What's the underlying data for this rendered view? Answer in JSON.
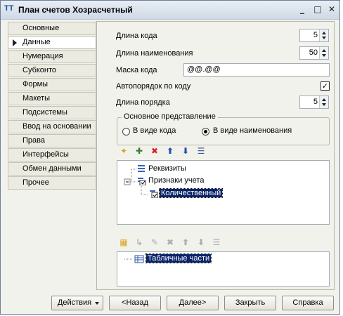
{
  "window": {
    "title": "План счетов Хозрасчетный",
    "app_icon": "ТТ"
  },
  "titlebar_buttons": {
    "minimize": "_",
    "maximize": "□",
    "close": "✕"
  },
  "nav": {
    "items": [
      {
        "label": "Основные"
      },
      {
        "label": "Данные",
        "active": true
      },
      {
        "label": "Нумерация"
      },
      {
        "label": "Субконто"
      },
      {
        "label": "Формы"
      },
      {
        "label": "Макеты"
      },
      {
        "label": "Подсистемы"
      },
      {
        "label": "Ввод на основании"
      },
      {
        "label": "Права"
      },
      {
        "label": "Интерфейсы"
      },
      {
        "label": "Обмен данными"
      },
      {
        "label": "Прочее"
      }
    ]
  },
  "fields": {
    "code_length": {
      "label": "Длина кода",
      "value": "5"
    },
    "name_length": {
      "label": "Длина наименования",
      "value": "50"
    },
    "code_mask": {
      "label": "Маска кода",
      "value": "@@.@@"
    },
    "auto_order": {
      "label": "Автопорядок по коду",
      "checked": true
    },
    "order_length": {
      "label": "Длина порядка",
      "value": "5"
    }
  },
  "representation": {
    "title": "Основное представление",
    "options": [
      {
        "label": "В виде кода",
        "selected": false
      },
      {
        "label": "В виде наименования",
        "selected": true
      }
    ]
  },
  "tree1": {
    "toolbar_icons": [
      "add-icon",
      "add-child-icon",
      "delete-icon",
      "move-up-icon",
      "move-down-icon",
      "sort-icon"
    ],
    "nodes": [
      {
        "label": "Реквизиты"
      },
      {
        "label": "Признаки учета"
      },
      {
        "label": "Количественный",
        "selected": true
      }
    ]
  },
  "tree2": {
    "toolbar_icons": [
      "add-icon",
      "add-child-icon",
      "edit-icon",
      "delete-icon",
      "move-up-icon",
      "move-down-icon",
      "sort-icon"
    ],
    "nodes": [
      {
        "label": "Табличные части"
      }
    ]
  },
  "buttons": {
    "actions": "Действия",
    "back": "<Назад",
    "next": "Далее>",
    "close": "Закрыть",
    "help": "Справка"
  },
  "colors": {
    "selection": "#0a246a",
    "panel": "#f2f2ec",
    "window_border": "#6f7f95"
  }
}
